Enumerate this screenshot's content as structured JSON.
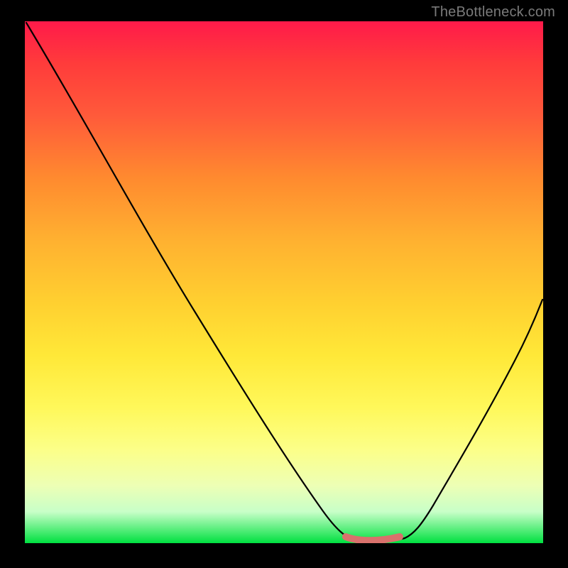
{
  "watermark": "TheBottleneck.com",
  "colors": {
    "frame": "#000000",
    "curve": "#000000",
    "highlight_segment": "#d9716c"
  },
  "chart_data": {
    "type": "line",
    "title": "",
    "xlabel": "",
    "ylabel": "",
    "xlim": [
      0,
      100
    ],
    "ylim": [
      0,
      100
    ],
    "grid": false,
    "legend": false,
    "series": [
      {
        "name": "curve",
        "x": [
          0,
          10,
          20,
          30,
          40,
          50,
          60,
          62,
          65,
          70,
          73,
          75,
          80,
          85,
          90,
          95,
          100
        ],
        "y": [
          100,
          85,
          70,
          54,
          38,
          22,
          6,
          2,
          0,
          0,
          0,
          3,
          12,
          22,
          34,
          45,
          56
        ]
      }
    ],
    "highlight_range_x": [
      62,
      73
    ],
    "note": "Values are estimated from the image; chart has no visible axis ticks or labels."
  }
}
